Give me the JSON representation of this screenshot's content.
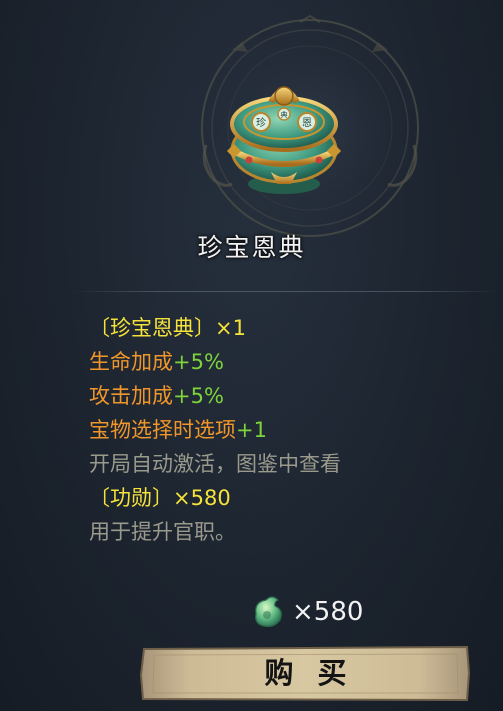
{
  "item": {
    "name": "珍宝恩典",
    "icon": "treasure-pot-icon",
    "icon_inscription": [
      "珍",
      "恩",
      "典"
    ]
  },
  "description": {
    "title_line": "〔珍宝恩典〕×1",
    "life_label": "生命加成",
    "life_value": "+5%",
    "attack_label": "攻击加成",
    "attack_value": "+5%",
    "option_label": "宝物选择时选项",
    "option_value": "+1",
    "note": "开局自动激活，图鉴中查看",
    "merit_line": "〔功勋〕×580",
    "usage": "用于提升官职。"
  },
  "price": {
    "currency_icon": "jade-currency-icon",
    "amount": "×580"
  },
  "buy_button": {
    "label": "购买"
  },
  "colors": {
    "background": "#1c242f",
    "gold_text": "#f5e23a",
    "orange_text": "#f0962a",
    "green_text": "#7ed43a",
    "grey_text": "#9a9a8c",
    "button_parchment": "#c9b68f"
  }
}
